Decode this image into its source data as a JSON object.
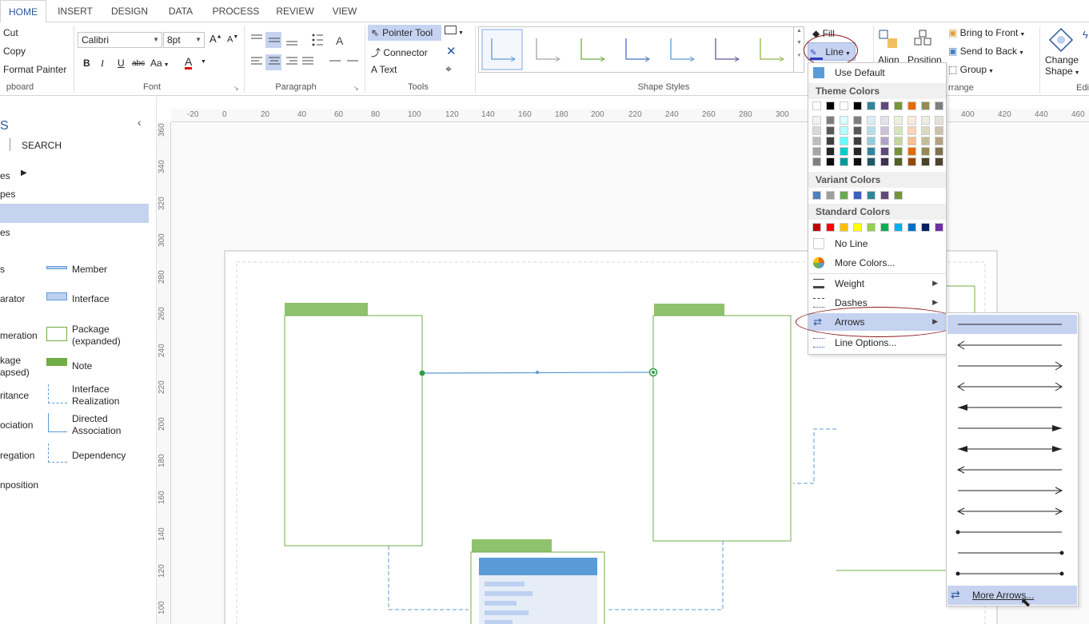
{
  "tabs": [
    "HOME",
    "INSERT",
    "DESIGN",
    "DATA",
    "PROCESS",
    "REVIEW",
    "VIEW"
  ],
  "clipboard": {
    "cut": "Cut",
    "copy": "Copy",
    "format_painter": "Format Painter",
    "group": "pboard"
  },
  "font": {
    "name": "Calibri",
    "size": "8pt",
    "bold": "B",
    "italic": "I",
    "underline": "U",
    "strike": "abc",
    "case": "Aa",
    "color": "A",
    "group": "Font"
  },
  "paragraph": {
    "group": "Paragraph"
  },
  "tools": {
    "pointer": "Pointer Tool",
    "connector": "Connector",
    "text": "Text",
    "group": "Tools"
  },
  "shape_styles": {
    "group": "Shape Styles",
    "fill": "Fill",
    "line": "Line",
    "colors": [
      "#5b9bd5",
      "#a5a5a5",
      "#70ad47",
      "#4472c4",
      "#5b9bd5",
      "#5a5a9c",
      "#8fb34a"
    ]
  },
  "arrange": {
    "align": "Align",
    "position": "Position",
    "bring_to_front": "Bring to Front",
    "send_to_back": "Send to Back",
    "group_btn": "Group",
    "group": "rrange"
  },
  "editing": {
    "change_shape": "Change",
    "change_shape2": "Shape",
    "edit": "Edi"
  },
  "left_panel": {
    "title": "S",
    "search": "SEARCH",
    "items": [
      "es",
      "pes",
      "es"
    ],
    "shapes": [
      {
        "label": "s"
      },
      {
        "label": "Member"
      },
      {
        "label": "arator"
      },
      {
        "label": "Interface"
      },
      {
        "label": "meration"
      },
      {
        "label": "Package\n(expanded)"
      },
      {
        "label": "kage\napsed)"
      },
      {
        "label": "Note"
      },
      {
        "label": "ritance"
      },
      {
        "label": "Interface\nRealization"
      },
      {
        "label": "ociation"
      },
      {
        "label": "Directed\nAssociation"
      },
      {
        "label": "regation"
      },
      {
        "label": "Dependency"
      },
      {
        "label": "nposition"
      }
    ]
  },
  "ruler": {
    "h": [
      "-20",
      "0",
      "20",
      "40",
      "60",
      "80",
      "100",
      "120",
      "140",
      "160",
      "180",
      "200",
      "220",
      "240",
      "260",
      "280",
      "300",
      "400",
      "420",
      "440",
      "460"
    ],
    "v": [
      "360",
      "340",
      "320",
      "300",
      "280",
      "260",
      "240",
      "220",
      "200",
      "180",
      "160",
      "140",
      "120",
      "100"
    ]
  },
  "line_menu": {
    "use_default": "Use Default",
    "theme_colors": "Theme Colors",
    "theme_top": [
      "#ffffff",
      "#000000",
      "#ffffff",
      "#000000",
      "#31849b",
      "#60497a",
      "#77933c",
      "#e36c09",
      "#948a54",
      "#7f7f7f"
    ],
    "theme_cols": [
      [
        "#f2f2f2",
        "#d9d9d9",
        "#bfbfbf",
        "#a6a6a6",
        "#808080"
      ],
      [
        "#7f7f7f",
        "#595959",
        "#3f3f3f",
        "#262626",
        "#0d0d0d"
      ],
      [
        "#d9ffff",
        "#b3ffff",
        "#66ffff",
        "#00cccc",
        "#009999"
      ],
      [
        "#7f7f7f",
        "#595959",
        "#3f3f3f",
        "#262626",
        "#0d0d0d"
      ],
      [
        "#dbeef3",
        "#b7dde8",
        "#92cddc",
        "#31859b",
        "#205867"
      ],
      [
        "#e5e0ec",
        "#ccc1d9",
        "#b2a2c7",
        "#5f497a",
        "#3f3151"
      ],
      [
        "#ebf1dd",
        "#d7e3bc",
        "#c3d69b",
        "#76923c",
        "#4f6128"
      ],
      [
        "#fdeada",
        "#fbd5b5",
        "#fac08f",
        "#e36c09",
        "#974806"
      ],
      [
        "#eeece1",
        "#ddd9c3",
        "#c4bd97",
        "#938953",
        "#494429"
      ],
      [
        "#e6e0d6",
        "#ccc1ad",
        "#b3a383",
        "#7f6f4f",
        "#4d4330"
      ]
    ],
    "variant_colors": "Variant Colors",
    "variant": [
      "#4f81bd",
      "#9e9e9e",
      "#6aa84f",
      "#3d5fbf",
      "#31859b",
      "#60497a",
      "#77933c"
    ],
    "standard_colors": "Standard Colors",
    "standard": [
      "#c00000",
      "#ff0000",
      "#ffc000",
      "#ffff00",
      "#92d050",
      "#00b050",
      "#00b0f0",
      "#0070c0",
      "#002060",
      "#7030a0"
    ],
    "no_line": "No Line",
    "more_colors": "More Colors...",
    "weight": "Weight",
    "dashes": "Dashes",
    "arrows": "Arrows",
    "line_options": "Line Options..."
  },
  "arrow_menu": {
    "more_arrows": "More Arrows..."
  }
}
